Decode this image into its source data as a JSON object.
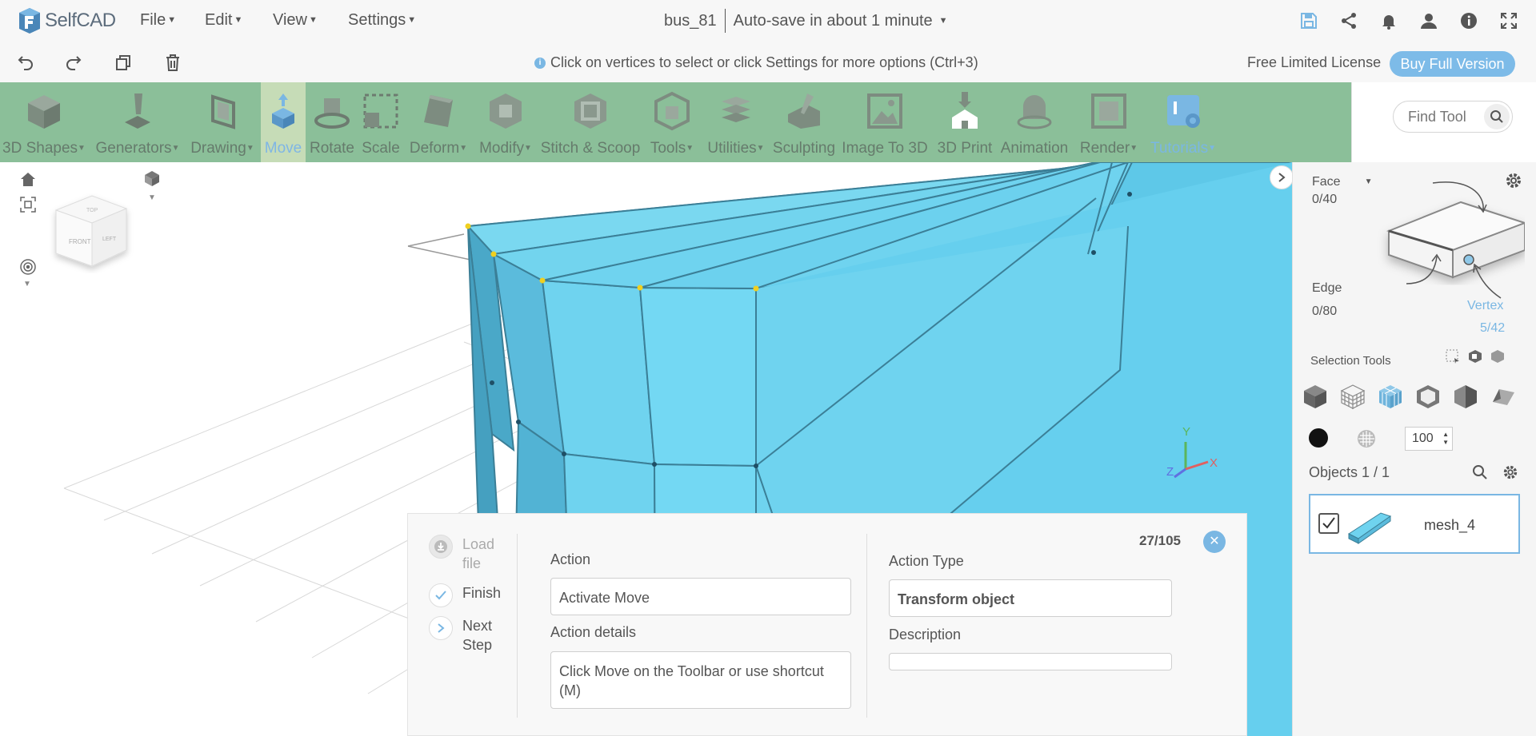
{
  "app": {
    "name": "SelfCAD"
  },
  "menus": [
    {
      "label": "File"
    },
    {
      "label": "Edit"
    },
    {
      "label": "View"
    },
    {
      "label": "Settings"
    }
  ],
  "document": {
    "title": "bus_81",
    "autosave": "Auto-save in about 1 minute"
  },
  "hint": "Click on vertices to select or click Settings for more options (Ctrl+3)",
  "license": {
    "text": "Free Limited License",
    "buy_label": "Buy Full Version"
  },
  "toolbar": {
    "tools": [
      {
        "label": "3D Shapes",
        "dropdown": true
      },
      {
        "label": "Generators",
        "dropdown": true
      },
      {
        "label": "Drawing",
        "dropdown": true
      },
      {
        "label": "Move",
        "active": true
      },
      {
        "label": "Rotate"
      },
      {
        "label": "Scale"
      },
      {
        "label": "Deform",
        "dropdown": true
      },
      {
        "label": "Modify",
        "dropdown": true
      },
      {
        "label": "Stitch & Scoop"
      },
      {
        "label": "Tools",
        "dropdown": true
      },
      {
        "label": "Utilities",
        "dropdown": true
      },
      {
        "label": "Sculpting"
      },
      {
        "label": "Image To 3D"
      },
      {
        "label": "3D Print"
      },
      {
        "label": "Animation"
      },
      {
        "label": "Render",
        "dropdown": true
      },
      {
        "label": "Tutorials",
        "dropdown": true,
        "highlight": true
      }
    ],
    "find_placeholder": "Find Tool"
  },
  "viewcube": {
    "front": "FRONT",
    "side": "LEFT",
    "top": "TOP"
  },
  "axes": {
    "y": "Y",
    "z": "Z",
    "x": "X"
  },
  "selection": {
    "face_label": "Face",
    "face_count": "0/40",
    "edge_label": "Edge",
    "edge_count": "0/80",
    "vertex_label": "Vertex",
    "vertex_count": "5/42",
    "tools_label": "Selection Tools",
    "radius_value": "100"
  },
  "objects": {
    "header": "Objects 1 / 1",
    "items": [
      {
        "name": "mesh_4",
        "checked": true
      }
    ]
  },
  "tutorial": {
    "counter": "27/105",
    "steps": [
      {
        "label": "Load file",
        "enabled": false
      },
      {
        "label": "Finish",
        "enabled": true
      },
      {
        "label": "Next Step",
        "enabled": true
      }
    ],
    "action_label": "Action",
    "action_value": "Activate Move",
    "action_details_label": "Action details",
    "action_details_value": "Click Move on the Toolbar or use shortcut (M)",
    "action_type_label": "Action Type",
    "action_type_value": "Transform object",
    "description_label": "Description",
    "description_value": ""
  },
  "colors": {
    "toolbar_bg": "#8bbf99",
    "toolbar_active": "#c6dcb7",
    "accent": "#7ab7e3",
    "mesh": "#6fd3ef",
    "vertex_selected": "#f0d020"
  }
}
